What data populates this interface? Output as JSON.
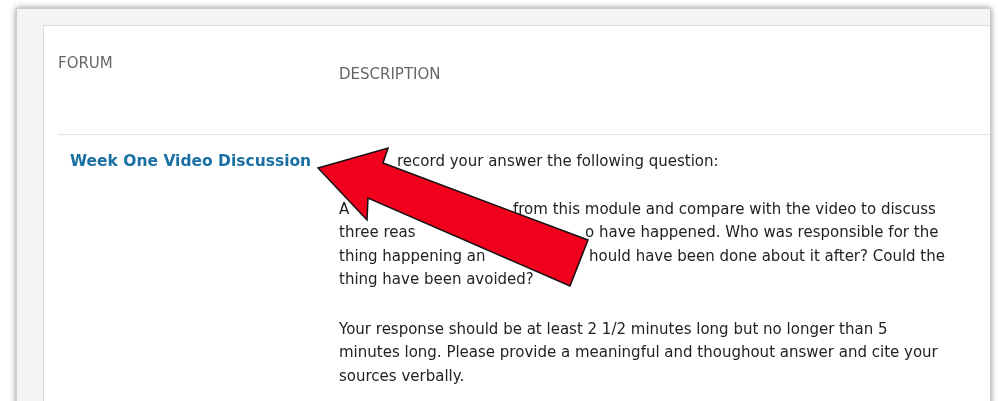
{
  "table": {
    "columns": [
      "FORUM",
      "DESCRIPTION"
    ],
    "rows": [
      {
        "forum": "Week One Video Discussion",
        "description": [
          {
            "kind": "covered",
            "lines": [
              [
                "record your answer the following question:"
              ]
            ]
          },
          {
            "kind": "covered",
            "lines": [
              [
                "A",
                "from this module and compare with the video to discuss"
              ],
              [
                "three reas",
                "o have happened.  Who was responsible for the"
              ],
              [
                "thing happening an",
                "hould have been done about it after? Could the"
              ],
              [
                "thing have been avoided?"
              ]
            ]
          },
          {
            "kind": "plain",
            "text": "Your response should be at least 2 1/2 minutes long but no longer than 5 minutes long. Please provide a meaningful and thoughout answer and cite your sources verbally."
          }
        ]
      }
    ]
  }
}
